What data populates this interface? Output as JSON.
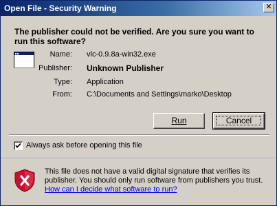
{
  "window": {
    "title": "Open File - Security Warning",
    "close_glyph": "✕"
  },
  "heading": "The publisher could not be verified.  Are you sure you want to run this software?",
  "file_icon": "application-window-icon",
  "fields": {
    "name_label": "Name:",
    "name_value": "vlc-0.9.8a-win32.exe",
    "publisher_label": "Publisher:",
    "publisher_value": "Unknown Publisher",
    "type_label": "Type:",
    "type_value": "Application",
    "from_label": "From:",
    "from_value": "C:\\Documents and Settings\\marko\\Desktop"
  },
  "buttons": {
    "run_label": "Run",
    "cancel_label": "Cancel"
  },
  "checkbox": {
    "label": "Always ask before opening this file",
    "checked": true
  },
  "warning": {
    "icon": "shield-x-icon",
    "text": "This file does not have a valid digital signature that verifies its publisher.  You should only run software from publishers you trust.",
    "link": "How can I decide what software to run?"
  },
  "colors": {
    "titlebar_start": "#0a246a",
    "titlebar_end": "#a6caf0",
    "dialog_bg": "#d4d0c8",
    "shield_red": "#c8102e",
    "link": "#0000ee"
  }
}
